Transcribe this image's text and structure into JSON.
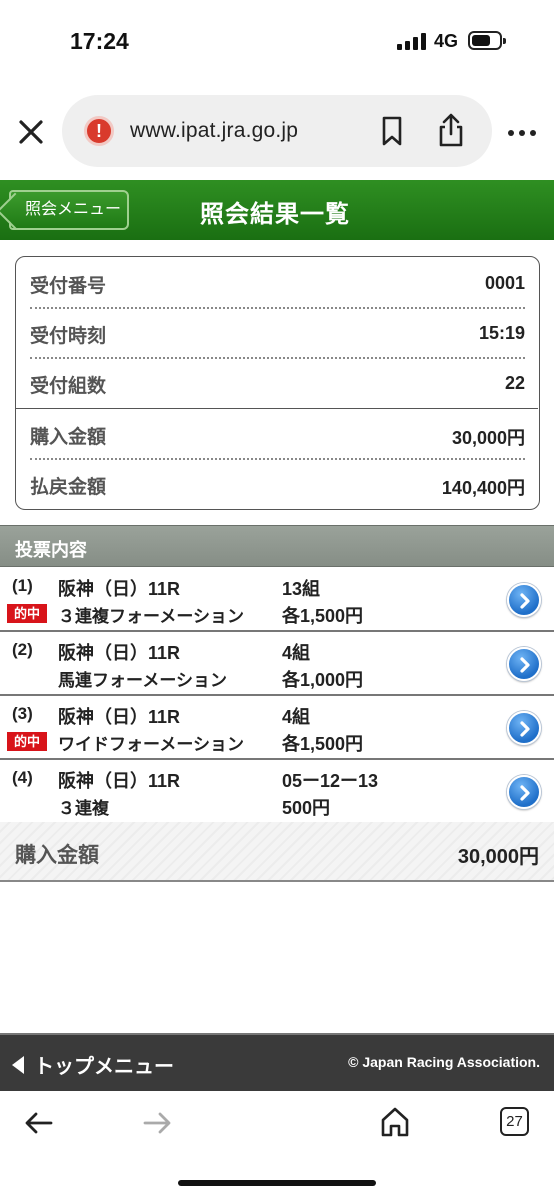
{
  "status_bar": {
    "time": "17:24",
    "network": "4G"
  },
  "browser": {
    "url": "www.ipat.jra.go.jp",
    "tab_count": "27"
  },
  "header": {
    "back_label": "照会メニュー",
    "title": "照会結果一覧"
  },
  "info": {
    "rows": [
      {
        "label": "受付番号",
        "value": "0001"
      },
      {
        "label": "受付時刻",
        "value": "15:19"
      },
      {
        "label": "受付組数",
        "value": "22"
      },
      {
        "label": "購入金額",
        "value": "30,000円"
      },
      {
        "label": "払戻金額",
        "value": "140,400円"
      }
    ]
  },
  "bets": {
    "section_title": "投票内容",
    "hit_label": "的中",
    "rows": [
      {
        "index": "(1)",
        "race": "阪神（日）11R",
        "type": "３連複フォーメーション",
        "count": "13組",
        "amount": "各1,500円",
        "hit": true
      },
      {
        "index": "(2)",
        "race": "阪神（日）11R",
        "type": "馬連フォーメーション",
        "count": "4組",
        "amount": "各1,000円",
        "hit": false
      },
      {
        "index": "(3)",
        "race": "阪神（日）11R",
        "type": "ワイドフォーメーション",
        "count": "4組",
        "amount": "各1,500円",
        "hit": true
      },
      {
        "index": "(4)",
        "race": "阪神（日）11R",
        "type": "３連複",
        "count": "05ー12ー13",
        "amount": "500円",
        "hit": false
      }
    ]
  },
  "total": {
    "label": "購入金額",
    "value": "30,000円"
  },
  "footer": {
    "top_menu": "トップメニュー",
    "copyright": "© Japan Racing Association."
  },
  "colors": {
    "header_green": "#1f7a15",
    "hit_red": "#d8141a",
    "link_blue": "#1f6fc9"
  }
}
